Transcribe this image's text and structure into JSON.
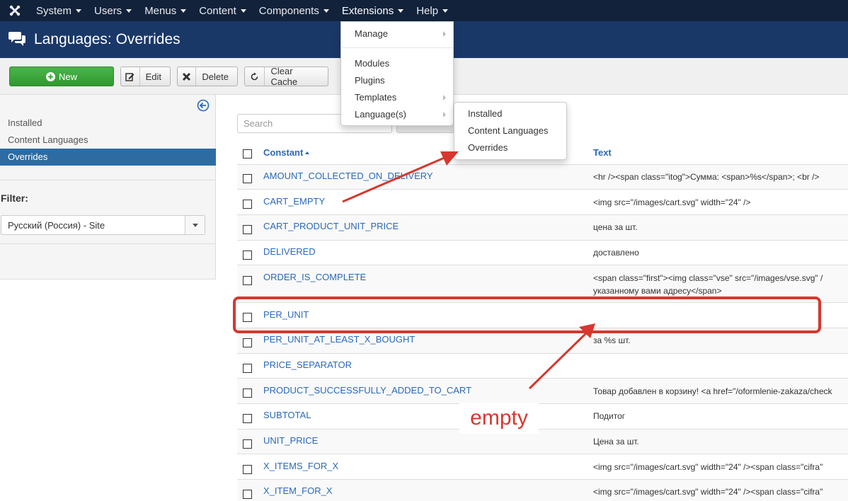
{
  "navbar": {
    "items": [
      {
        "label": "System"
      },
      {
        "label": "Users"
      },
      {
        "label": "Menus"
      },
      {
        "label": "Content"
      },
      {
        "label": "Components"
      },
      {
        "label": "Extensions"
      },
      {
        "label": "Help"
      }
    ]
  },
  "header": {
    "title": "Languages: Overrides"
  },
  "toolbar": {
    "new_label": "New",
    "edit_label": "Edit",
    "delete_label": "Delete",
    "clear_cache_label": "Clear Cache"
  },
  "sidebar": {
    "items": [
      {
        "label": "Installed"
      },
      {
        "label": "Content Languages"
      },
      {
        "label": "Overrides"
      }
    ],
    "filter_label": "Filter:",
    "filter_value": "Русский (Россия) - Site"
  },
  "search": {
    "placeholder": "Search"
  },
  "table": {
    "headers": {
      "constant": "Constant",
      "text": "Text"
    },
    "rows": [
      {
        "constant": "AMOUNT_COLLECTED_ON_DELIVERY",
        "text": "<hr /><span class=\"itog\">Сумма: <span>%s</span>; <br />"
      },
      {
        "constant": "CART_EMPTY",
        "text": "<img src=\"/images/cart.svg\" width=\"24\" />"
      },
      {
        "constant": "CART_PRODUCT_UNIT_PRICE",
        "text": "цена за шт."
      },
      {
        "constant": "DELIVERED",
        "text": "доставлено"
      },
      {
        "constant": "ORDER_IS_COMPLETE",
        "text": "<span class=\"first\"><img class=\"vse\" src=\"/images/vse.svg\" /",
        "text2": "указанному вами адресу</span>"
      },
      {
        "constant": "PER_UNIT",
        "text": ""
      },
      {
        "constant": "PER_UNIT_AT_LEAST_X_BOUGHT",
        "text": "за %s шт."
      },
      {
        "constant": "PRICE_SEPARATOR",
        "text": ""
      },
      {
        "constant": "PRODUCT_SUCCESSFULLY_ADDED_TO_CART",
        "text": "Товар добавлен в корзину! <a href=\"/oformlenie-zakaza/check"
      },
      {
        "constant": "SUBTOTAL",
        "text": "Подитог"
      },
      {
        "constant": "UNIT_PRICE",
        "text": "Цена за шт."
      },
      {
        "constant": "X_ITEMS_FOR_X",
        "text": "<img src=\"/images/cart.svg\" width=\"24\" /><span class=\"cifra\""
      },
      {
        "constant": "X_ITEM_FOR_X",
        "text": "<img src=\"/images/cart.svg\" width=\"24\" /><span class=\"cifra\""
      }
    ]
  },
  "extensions_menu": {
    "items": [
      {
        "label": "Manage"
      },
      {
        "label": "Modules"
      },
      {
        "label": "Plugins"
      },
      {
        "label": "Templates"
      },
      {
        "label": "Language(s)"
      }
    ]
  },
  "languages_submenu": {
    "items": [
      {
        "label": "Installed"
      },
      {
        "label": "Content Languages"
      },
      {
        "label": "Overrides"
      }
    ]
  },
  "annotation": {
    "label": "empty",
    "color": "#d7372e"
  },
  "colors": {
    "navbar": "#12223b",
    "header": "#1a3867",
    "link": "#2a69b8",
    "active": "#2d6ca2",
    "new_button": "#3ca63c"
  }
}
